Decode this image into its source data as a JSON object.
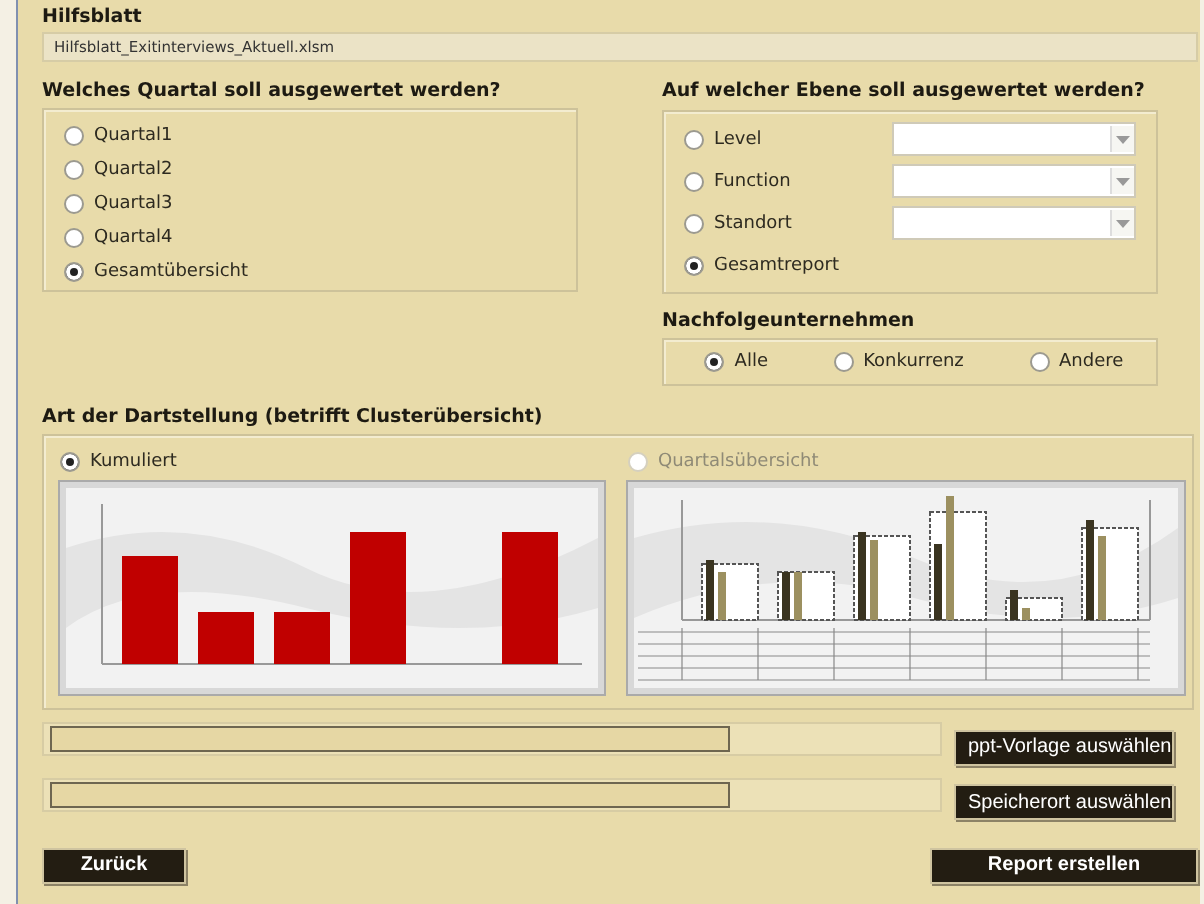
{
  "file": {
    "label": "Hilfsblatt",
    "value": "Hilfsblatt_Exitinterviews_Aktuell.xlsm"
  },
  "quarter": {
    "heading": "Welches Quartal soll ausgewertet werden?",
    "options": [
      {
        "label": "Quartal1",
        "selected": false
      },
      {
        "label": "Quartal2",
        "selected": false
      },
      {
        "label": "Quartal3",
        "selected": false
      },
      {
        "label": "Quartal4",
        "selected": false
      },
      {
        "label": "Gesamtübersicht",
        "selected": true
      }
    ]
  },
  "level": {
    "heading": "Auf welcher Ebene soll ausgewertet werden?",
    "options": [
      {
        "label": "Level",
        "selected": false,
        "kind": "dropdown"
      },
      {
        "label": "Function",
        "selected": false,
        "kind": "dropdown"
      },
      {
        "label": "Standort",
        "selected": false,
        "kind": "dropdown"
      },
      {
        "label": "Gesamtreport",
        "selected": true,
        "kind": "plain"
      }
    ]
  },
  "successor": {
    "heading": "Nachfolgeunternehmen",
    "options": [
      {
        "label": "Alle",
        "selected": true
      },
      {
        "label": "Konkurrenz",
        "selected": false
      },
      {
        "label": "Andere",
        "selected": false
      }
    ]
  },
  "display": {
    "heading": "Art der Dartstellung (betrifft Clusterübersicht)",
    "options": [
      {
        "label": "Kumuliert",
        "selected": true,
        "disabled": false,
        "kind": "cumulative"
      },
      {
        "label": "Quartalsübersicht",
        "selected": false,
        "disabled": true,
        "kind": "quarterly"
      }
    ]
  },
  "paths": [
    {
      "button": "ppt-Vorlage auswählen"
    },
    {
      "button": "Speicherort auswählen"
    }
  ],
  "buttons": [
    {
      "label": "Zurück"
    },
    {
      "label": "Report erstellen"
    }
  ]
}
